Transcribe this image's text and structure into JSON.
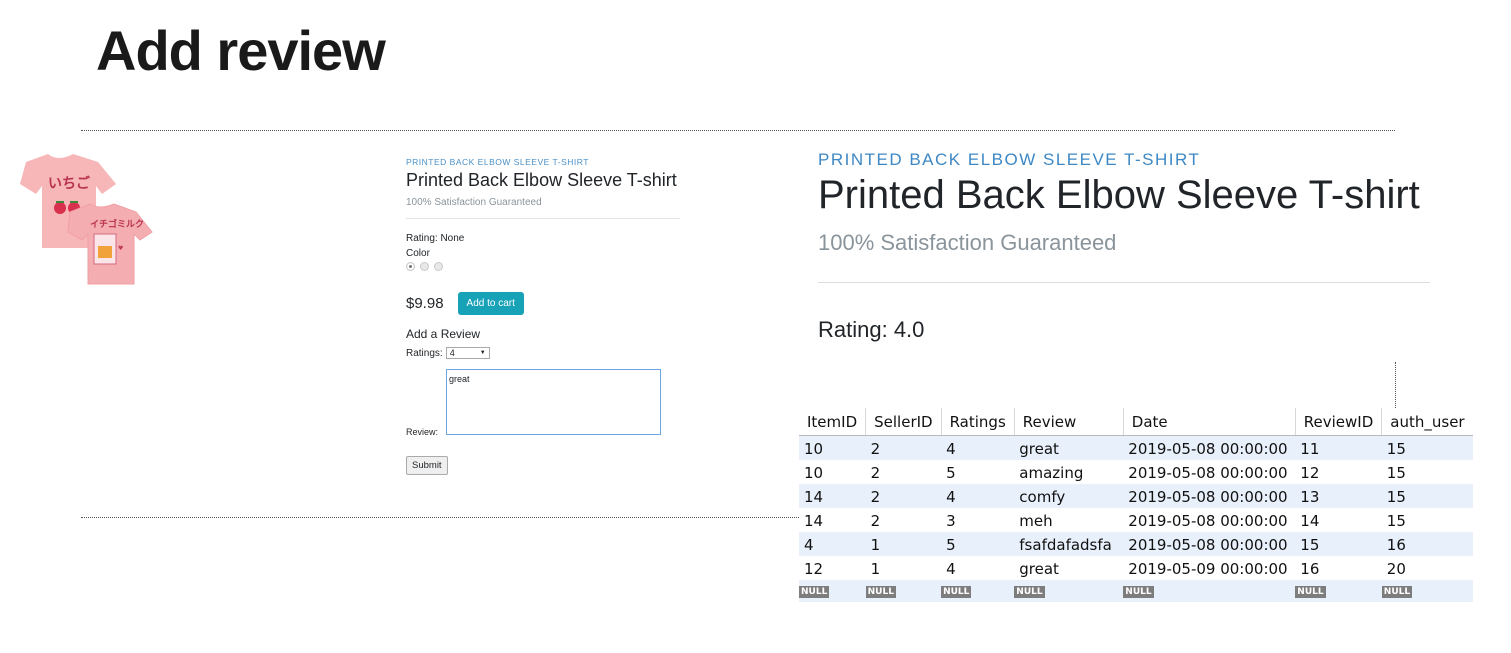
{
  "slide": {
    "title": "Add review"
  },
  "small": {
    "category": "PRINTED BACK ELBOW SLEEVE T-SHIRT",
    "product_name": "Printed Back Elbow Sleeve T-shirt",
    "tagline": "100% Satisfaction Guaranteed",
    "rating_text": "Rating: None",
    "color_label": "Color",
    "price": "$9.98",
    "add_to_cart": "Add to cart",
    "add_review_heading": "Add a Review",
    "ratings_label": "Ratings:",
    "ratings_value": "4",
    "review_label": "Review:",
    "review_text": "great",
    "submit_label": "Submit"
  },
  "large": {
    "category": "PRINTED BACK ELBOW SLEEVE T-SHIRT",
    "product_name": "Printed Back Elbow Sleeve T-shirt",
    "tagline": "100% Satisfaction Guaranteed",
    "rating_text": "Rating: 4.0"
  },
  "product_image": {
    "front_text": "いちご",
    "back_text": "イチゴミルク",
    "color": "#f7b6b8"
  },
  "table": {
    "headers": [
      "ItemID",
      "SellerID",
      "Ratings",
      "Review",
      "Date",
      "ReviewID",
      "auth_user"
    ],
    "rows": [
      [
        "10",
        "2",
        "4",
        "great",
        "2019-05-08 00:00:00",
        "11",
        "15"
      ],
      [
        "10",
        "2",
        "5",
        "amazing",
        "2019-05-08 00:00:00",
        "12",
        "15"
      ],
      [
        "14",
        "2",
        "4",
        "comfy",
        "2019-05-08 00:00:00",
        "13",
        "15"
      ],
      [
        "14",
        "2",
        "3",
        "meh",
        "2019-05-08 00:00:00",
        "14",
        "15"
      ],
      [
        "4",
        "1",
        "5",
        "fsafdafadsfa",
        "2019-05-08 00:00:00",
        "15",
        "16"
      ],
      [
        "12",
        "1",
        "4",
        "great",
        "2019-05-09 00:00:00",
        "16",
        "20"
      ]
    ],
    "null_label": "NULL"
  },
  "colors": {
    "accent": "#17a2b8",
    "category_blue": "#3d88c4",
    "muted": "#8a949b"
  }
}
